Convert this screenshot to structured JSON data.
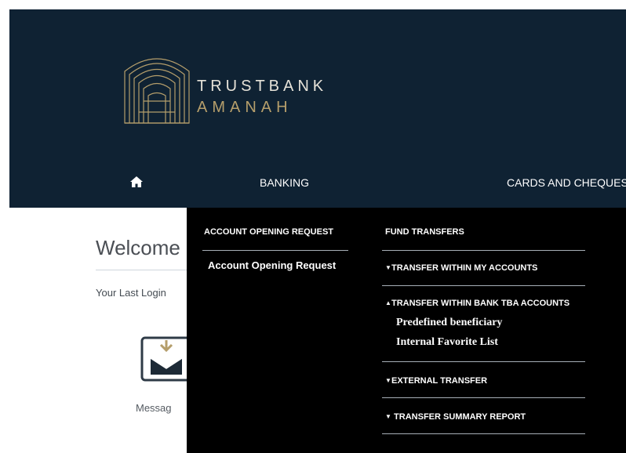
{
  "brand": {
    "primary": "TRUSTBANK",
    "secondary": "AMANAH"
  },
  "nav": {
    "home_icon": "home-icon",
    "items": [
      {
        "label": "BANKING"
      },
      {
        "label": "CARDS AND CHEQUES"
      }
    ]
  },
  "welcome": {
    "title": "Welcome",
    "last_login": "Your Last Login",
    "messages_label": "Messag"
  },
  "dropdown": {
    "left_column": {
      "heading": "ACCOUNT OPENING REQUEST",
      "item": "Account Opening Request"
    },
    "right_column": {
      "heading": "FUND TRANSFERS",
      "sections": [
        {
          "label": "TRANSFER WITHIN MY ACCOUNTS",
          "state": "collapsed"
        },
        {
          "label": "TRANSFER WITHIN BANK TBA ACCOUNTS",
          "state": "expanded",
          "items": [
            "Predefined beneficiary",
            "Internal Favorite List"
          ]
        },
        {
          "label": "EXTERNAL TRANSFER",
          "state": "collapsed"
        },
        {
          "label": " TRANSFER SUMMARY REPORT",
          "state": "collapsed"
        }
      ]
    }
  },
  "icons": {
    "logo": "trustbank-logo-icon",
    "messages": "message-inbox-icon"
  },
  "colors": {
    "header_bg": "#0f2233",
    "dropdown_bg": "#000000",
    "gold": "#b59e6b",
    "text_light": "#e6e2d8"
  }
}
